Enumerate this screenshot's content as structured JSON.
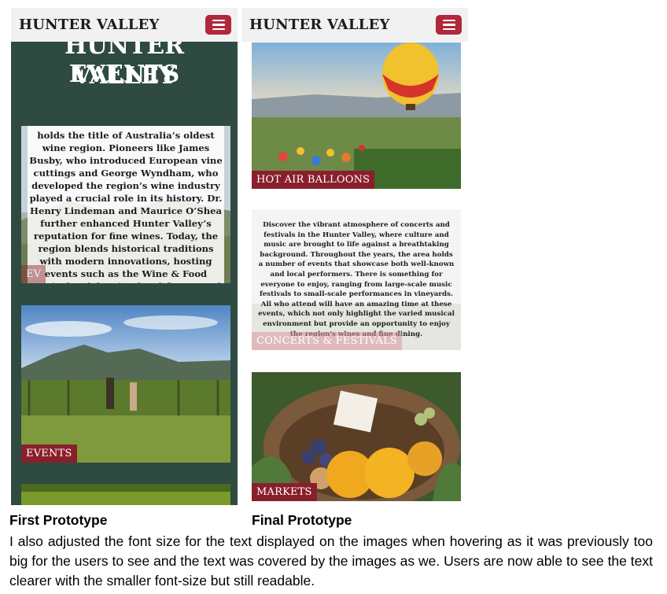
{
  "prototype1": {
    "header": {
      "brand": "HUNTER VALLEY",
      "menu_icon": "hamburger-menu-icon"
    },
    "hero_title_line1": "HUNTER VALLEY",
    "hero_title_line2": "EVENTS",
    "card1": {
      "overlay_text": "holds the title of Australia’s oldest wine region. Pioneers like James Busby, who introduced European vine cuttings and George Wyndham, who developed the region’s wine industry played a crucial role in its history. Dr. Henry Lindeman and Maurice O’Shea further enhanced Hunter Valley’s reputation for fine wines. Today, the region blends historical traditions with modern innovations, hosting events such as the Wine & Food Festival, celebrating local flavors and",
      "label": "EV"
    },
    "card2": {
      "label": "EVENTS"
    }
  },
  "prototype2": {
    "header": {
      "brand": "HUNTER VALLEY",
      "menu_icon": "hamburger-menu-icon"
    },
    "card1": {
      "label": "HOT AIR BALLOONS"
    },
    "card2": {
      "overlay_text": "Discover the vibrant atmosphere of concerts and festivals in the Hunter Valley, where culture and music are brought to life against a breathtaking background. Throughout the years, the area holds a number of events that showcase both well-known and local performers. There is something for everyone to enjoy, ranging from large-scale music festivals to small-scale performances in vineyards. All who attend will have an amazing time at these events, which not only highlight the varied musical environment but provide an opportunity to enjoy the region's wines and fine dining.",
      "label": "CONCERTS & FESTIVALS"
    },
    "card3": {
      "label": "MARKETS"
    }
  },
  "captions": {
    "first": "First Prototype",
    "final": "Final Prototype"
  },
  "description": "I also adjusted the font size for the text displayed on the images when hovering as it was previously too big for the users to see and the text was covered by the images as we. Users are now able to see the text clearer with the smaller font-size but still readable.",
  "colors": {
    "accent": "#b0283a",
    "label_bg": "#8a1f2c",
    "proto1_bg": "#2f4a41",
    "header_bg": "#f1f1f1"
  }
}
